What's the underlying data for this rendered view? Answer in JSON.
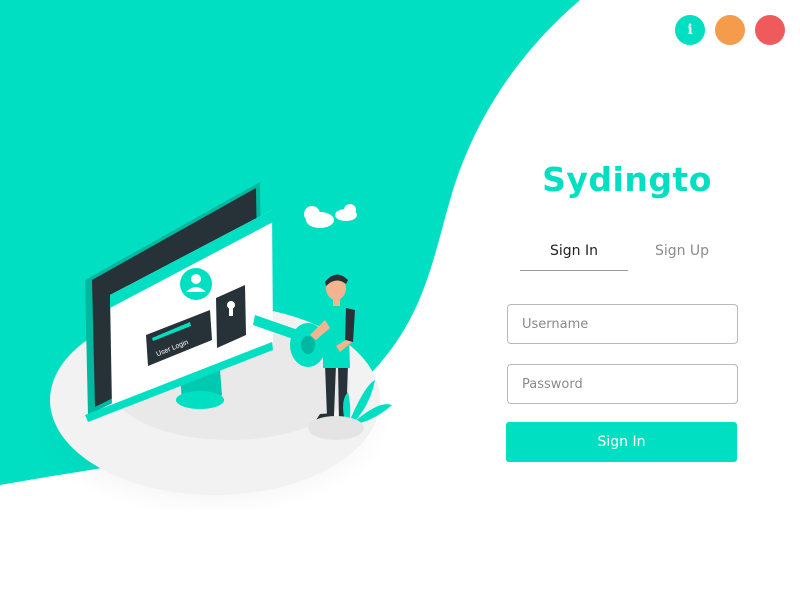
{
  "colors": {
    "accent": "#00dfc2",
    "info": "#00dfc2",
    "minimize": "#f59b4c",
    "close": "#ef5b5d",
    "dark": "#263238"
  },
  "window_controls": {
    "info_glyph": "i",
    "info_icon": "info-icon",
    "minimize_icon": "minimize-dot-icon",
    "close_icon": "close-dot-icon"
  },
  "illustration": {
    "screen_label": "User Login",
    "icons": [
      "monitor-icon",
      "user-avatar-icon",
      "keyhole-icon",
      "key-icon",
      "person-icon",
      "plant-icon",
      "cloud-icon"
    ]
  },
  "form": {
    "brand": "Sydingto",
    "tabs": [
      {
        "label": "Sign In",
        "active": true
      },
      {
        "label": "Sign Up",
        "active": false
      }
    ],
    "username_placeholder": "Username",
    "password_placeholder": "Password",
    "submit_label": "Sign In"
  }
}
